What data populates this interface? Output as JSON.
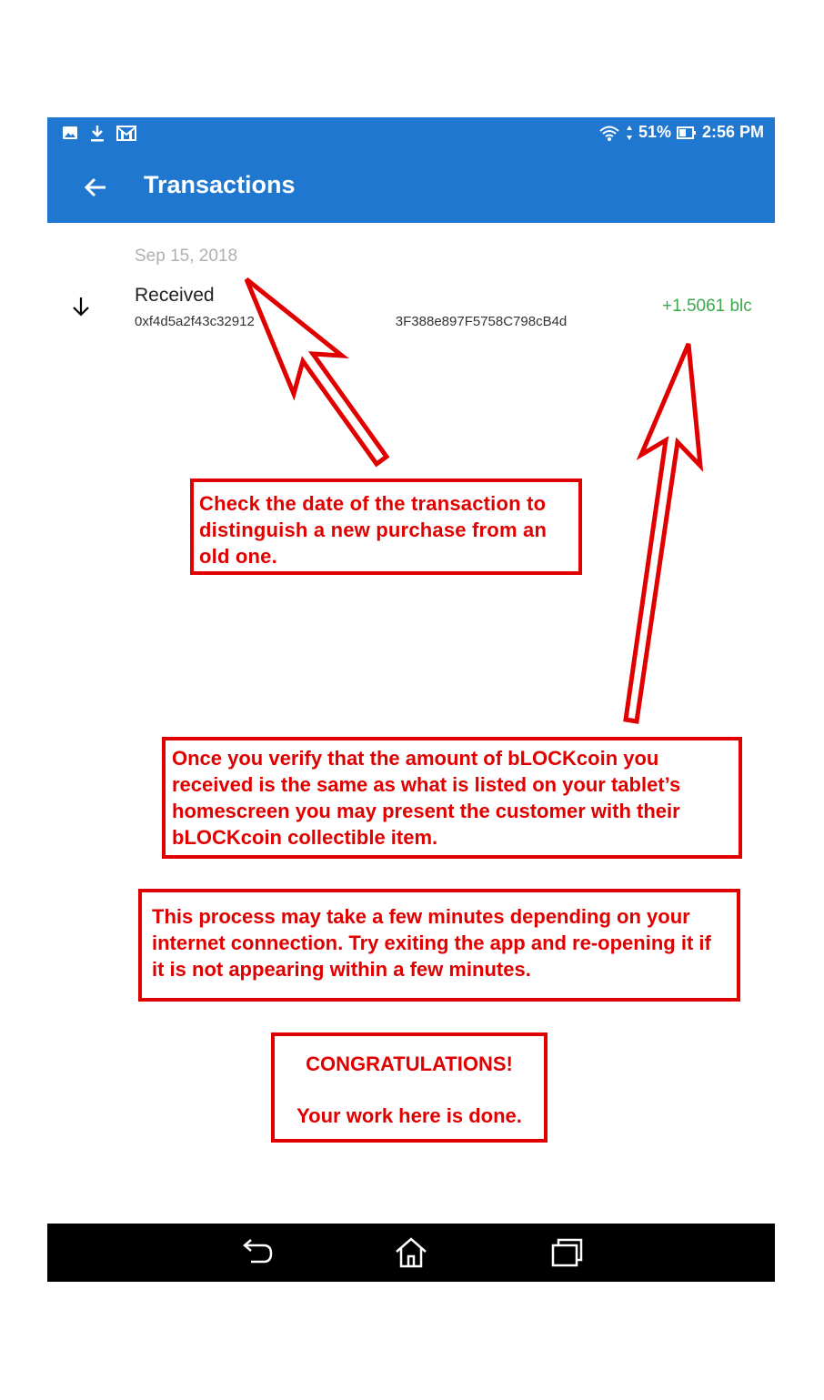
{
  "status_bar": {
    "icons_left": [
      "image-icon",
      "download-icon",
      "gmail-icon"
    ],
    "battery": "51%",
    "time": "2:56 PM"
  },
  "toolbar": {
    "title": "Transactions"
  },
  "transaction": {
    "date": "Sep 15, 2018",
    "type": "Received",
    "address_visible": "0xf4d5a2f43c32912",
    "address_visible_end": "3F388e897F5758C798cB4d",
    "amount": "+1.5061 blc"
  },
  "annotations": {
    "note1": "Check the date of the transaction to distinguish a new purchase from an old one.",
    "note2": "Once you verify that the amount of bLOCKcoin you received is the same as what is listed on your tablet’s homescreen you may present the customer with their bLOCKcoin collectible item.",
    "note3": "This process may take a few minutes depending on your internet connection.  Try exiting the app and re-opening it if it is not appearing within a few minutes.",
    "note4_line1": "CONGRATULATIONS!",
    "note4_line2": "Your work here is done."
  },
  "colors": {
    "appbar": "#1f77d0",
    "annotation": "#e00000",
    "amount": "#3aaa4a"
  }
}
